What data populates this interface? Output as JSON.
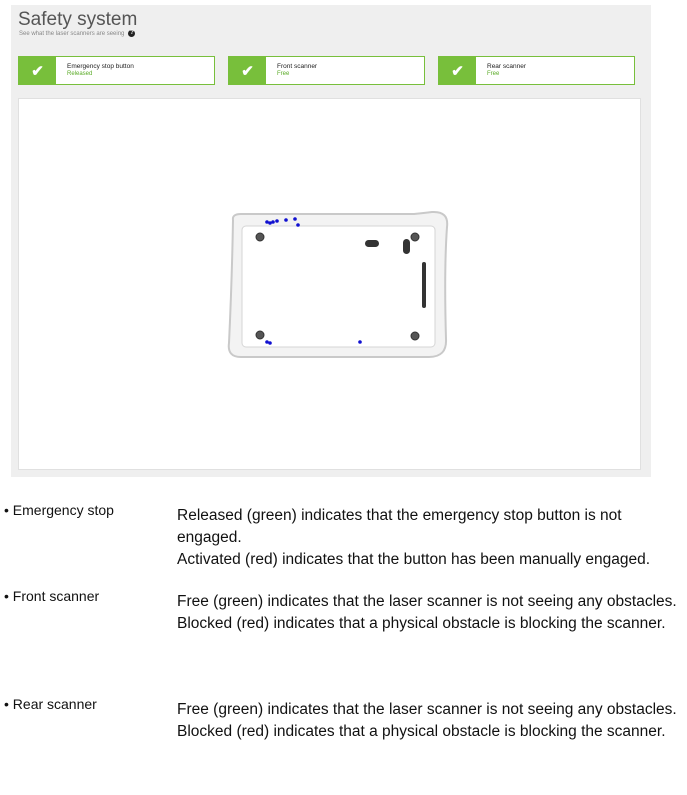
{
  "panel": {
    "title": "Safety system",
    "subtitle": "See what the laser scanners are seeing",
    "help_icon": "help-circle-icon"
  },
  "status_cards": [
    {
      "name": "Emergency stop button",
      "value": "Released",
      "icon": "check-icon"
    },
    {
      "name": "Front scanner",
      "value": "Free",
      "icon": "check-icon"
    },
    {
      "name": "Rear scanner",
      "value": "Free",
      "icon": "check-icon"
    }
  ],
  "colors": {
    "ok_green": "#78bf3b",
    "ok_text": "#5aab26",
    "scan_points": "#1010d0"
  },
  "legend": [
    {
      "label": "• Emergency stop",
      "lines": [
        "Released (green) indicates that the emergency stop button is not engaged.",
        "Activated (red) indicates that the button has been manually engaged."
      ]
    },
    {
      "label": "• Front scanner",
      "lines": [
        "Free (green) indicates that the laser scanner is not seeing any obstacles.",
        "Blocked (red) indicates that a physical obstacle is blocking the scanner."
      ]
    },
    {
      "label": "• Rear scanner",
      "lines": [
        "Free (green) indicates that the laser scanner is not seeing any obstacles.",
        "Blocked (red) indicates that a physical obstacle is blocking the scanner."
      ]
    }
  ]
}
